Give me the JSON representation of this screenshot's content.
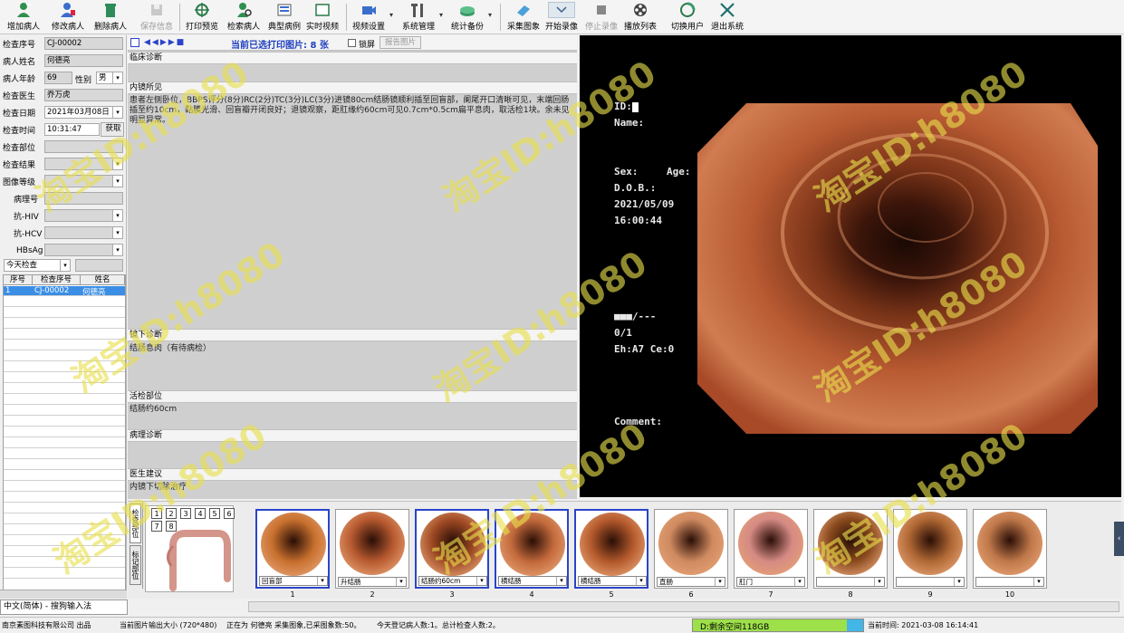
{
  "toolbar": {
    "items": [
      {
        "label": "增加病人",
        "icon": "user-add-icon"
      },
      {
        "label": "修改病人",
        "icon": "user-edit-icon"
      },
      {
        "label": "删除病人",
        "icon": "trash-icon"
      },
      {
        "label": "保存信息",
        "icon": "save-icon"
      },
      {
        "label": "打印预览",
        "icon": "print-preview-icon"
      },
      {
        "label": "检索病人",
        "icon": "search-user-icon"
      },
      {
        "label": "典型病例",
        "icon": "case-icon"
      },
      {
        "label": "实时视频",
        "icon": "video-icon"
      },
      {
        "label": "视频设置",
        "icon": "video-settings-icon"
      },
      {
        "label": "系统管理",
        "icon": "tools-icon"
      },
      {
        "label": "统计备份",
        "icon": "database-icon"
      },
      {
        "label": "采集图象",
        "icon": "capture-icon"
      },
      {
        "label": "开始录像",
        "icon": "chevron-down-icon"
      },
      {
        "label": "停止录像",
        "icon": "stop-icon"
      },
      {
        "label": "播放列表",
        "icon": "film-reel-icon"
      },
      {
        "label": "切换用户",
        "icon": "switch-user-icon"
      },
      {
        "label": "退出系统",
        "icon": "exit-icon"
      }
    ]
  },
  "patient_form": {
    "exam_no_label": "检查序号",
    "exam_no": "CJ-00002",
    "name_label": "病人姓名",
    "name": "何德亮",
    "age_label": "病人年龄",
    "age": "69",
    "sex_label": "性别",
    "sex": "男",
    "doctor_label": "检查医生",
    "doctor": "乔万虎",
    "date_label": "检查日期",
    "date": "2021年03月08日",
    "time_label": "检查时间",
    "time": "10:31:47",
    "fetch_button": "获取",
    "site_label": "检查部位",
    "result_label": "检查结果",
    "grade_label": "图像等级",
    "pathology_no_label": "病理号",
    "hiv_label": "抗-HIV",
    "hcv_label": "抗-HCV",
    "hbsag_label": "HBsAg",
    "filter_select": "今天检查"
  },
  "patient_table": {
    "headers": [
      "序号",
      "检查序号",
      "姓名"
    ],
    "rows": [
      {
        "no": "1",
        "exam_no": "CJ-00002",
        "name": "何德亮"
      }
    ]
  },
  "input_method": "中文(简体) - 搜狗输入法",
  "report": {
    "nav_status": "当前已选打印图片: 8 张",
    "lock_label": "锁屏",
    "report_button": "报告图片",
    "sections": [
      {
        "title": "临床诊断",
        "text": ""
      },
      {
        "title": "内镜所见",
        "text": "患者左侧卧位，BBPS评分(8分)RC(2分)TC(3分)LC(3分)进镜80cm结肠镜顺利插至回盲部，阑尾开口清晰可见，末端回肠插至约10cm，黏膜光滑、回盲瓣开闭良好；退镜观察，距肛缘约60cm可见0.7cm*0.5cm扁平息肉，取活检1块。余未见明显异常。"
      },
      {
        "title": "镜下诊断",
        "text": "结肠息肉（有待病检）"
      },
      {
        "title": "活检部位",
        "text": "结肠约60cm"
      },
      {
        "title": "病理诊断",
        "text": ""
      },
      {
        "title": "医生建议",
        "text": "内镜下切除治疗"
      }
    ]
  },
  "video_overlay": {
    "id_label": "ID:",
    "name_label": "Name:",
    "sex_label": "Sex:",
    "age_label": "Age:",
    "dob_label": "D.O.B.:",
    "date": "2021/05/09",
    "time": "16:00:44",
    "bars": "■■■/---",
    "fraction": "0/1",
    "eh": "Eh:A7 Ce:0",
    "comment_label": "Comment:"
  },
  "thumb_tabs": {
    "tab1": "检查部位",
    "tab2": "标记部位",
    "site_numbers": [
      "1",
      "2",
      "3",
      "4",
      "5",
      "6",
      "7",
      "8"
    ]
  },
  "thumbnails": [
    {
      "label": "回盲部",
      "num": "1",
      "selected": true
    },
    {
      "label": "升结肠",
      "num": "2",
      "selected": false
    },
    {
      "label": "结肠约60cm",
      "num": "3",
      "selected": true
    },
    {
      "label": "横结肠",
      "num": "4",
      "selected": true
    },
    {
      "label": "横结肠",
      "num": "5",
      "selected": true
    },
    {
      "label": "直肠",
      "num": "6",
      "selected": false
    },
    {
      "label": "肛门",
      "num": "7",
      "selected": false
    },
    {
      "label": "",
      "num": "8",
      "selected": false
    },
    {
      "label": "",
      "num": "9",
      "selected": false
    },
    {
      "label": "",
      "num": "10",
      "selected": false
    }
  ],
  "status": {
    "company": "南京素图科技有限公司 出品",
    "output_size": "当前图片输出大小 (720*480)",
    "current": "正在为 何德亮 采集图象,已采图象数:50。",
    "today": "今天登记病人数:1。",
    "total": "总计检查人数:2。",
    "disk": "D:剩余空间118GB",
    "datetime": "当前时间: 2021-03-08 16:14:41"
  },
  "watermark": "淘宝ID:h8080",
  "colors": {
    "selected_row": "#3a8ee6",
    "selected_thumb_border": "#2a44c9",
    "disk_bar": "#9ee04a",
    "title_blue": "#1f3fbf"
  }
}
